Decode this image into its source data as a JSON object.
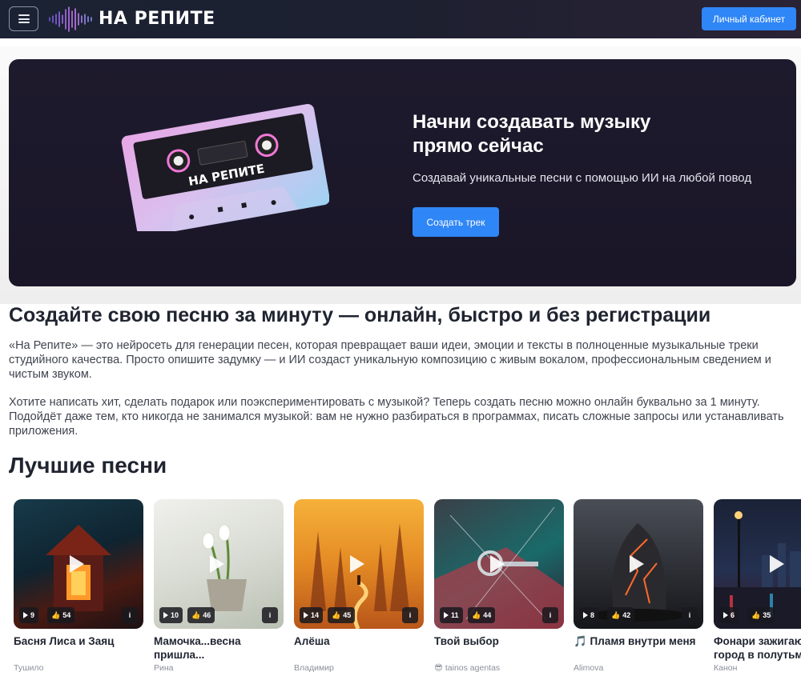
{
  "header": {
    "menu_icon": "hamburger-icon",
    "logo_text": "НА РЕПИТЕ",
    "cabinet_label": "Личный кабинет"
  },
  "hero": {
    "cassette_label": "НА РЕПИТЕ",
    "title_line1": "Начни создавать музыку",
    "title_line2": "прямо сейчас",
    "subtitle": "Создавай уникальные песни с помощью ИИ на любой повод",
    "cta_label": "Создать трек"
  },
  "intro": {
    "heading": "Создайте свою песню за минуту — онлайн, быстро и без регистрации",
    "paragraph1": "«На Репите» — это нейросеть для генерации песен, которая превращает ваши идеи, эмоции и тексты в полноценные музыкальные треки студийного качества. Просто опишите задумку — и ИИ создаст уникальную композицию с живым вокалом, профессиональным сведением и чистым звуком.",
    "paragraph2": "Хотите написать хит, сделать подарок или поэкспериментировать с музыкой? Теперь создать песню можно онлайн буквально за 1 минуту. Подойдёт даже тем, кто никогда не занимался музыкой: вам не нужно разбираться в программах, писать сложные запросы или устанавливать приложения."
  },
  "best": {
    "heading": "Лучшие песни",
    "songs": [
      {
        "title": "Басня Лиса и Заяц",
        "author": "Тушило",
        "plays": "9",
        "likes": "54"
      },
      {
        "title": "Мамочка...весна пришла...",
        "author": "Рина",
        "plays": "10",
        "likes": "46"
      },
      {
        "title": "Алёша",
        "author": "Владимир",
        "plays": "14",
        "likes": "45"
      },
      {
        "title": "Твой выбор",
        "author": "😎 tainos agentas",
        "plays": "11",
        "likes": "44"
      },
      {
        "title": "🎵 Пламя внутри меня",
        "author": "Alimova",
        "plays": "8",
        "likes": "42"
      },
      {
        "title": "Фонари зажигаются, город в полутьме",
        "author": "Канон",
        "plays": "6",
        "likes": "35"
      }
    ],
    "info_label": "i"
  },
  "colors": {
    "accent": "#2f86f6",
    "hero_bg": "#1e1a2d",
    "header_bg": "#1b2233"
  }
}
